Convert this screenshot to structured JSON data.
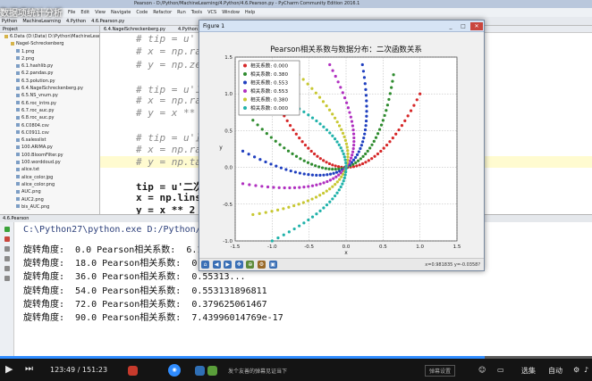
{
  "ide": {
    "title": "Pearson - D:/Python/MachineLearning/4.Python/4.6.Pearson.py - PyCharm Community Edition 2016.1",
    "overlay_title": "数据项统计分析",
    "menu": [
      "File",
      "Edit",
      "View",
      "Navigate",
      "Code",
      "Refactor",
      "Run",
      "Tools",
      "VCS",
      "Window",
      "Help"
    ],
    "toolbar": [
      "Python",
      "MachineLearning",
      "4.Python",
      "4.6.Pearson.py"
    ]
  },
  "project": {
    "header": "Project",
    "items": [
      {
        "label": "6.Data  (D:\\Data)  D:\\Python\\MachineLearn",
        "level": 0
      },
      {
        "label": "Nagel-Schreckenberg",
        "level": 1
      },
      {
        "label": "1.png",
        "level": 2
      },
      {
        "label": "2.png",
        "level": 2
      },
      {
        "label": "6.1.hashlib.py",
        "level": 2
      },
      {
        "label": "6.2.pandas.py",
        "level": 2
      },
      {
        "label": "6.3.polution.py",
        "level": 2
      },
      {
        "label": "6.4.NagelSchreckenberg.py",
        "level": 2
      },
      {
        "label": "6.5.NS_vnum.py",
        "level": 2
      },
      {
        "label": "6.6.roc_intro.py",
        "level": 2
      },
      {
        "label": "6.7.roc_auc.py",
        "level": 2
      },
      {
        "label": "6.8.roc_auc.py",
        "level": 2
      },
      {
        "label": "6.C0804.csv",
        "level": 2
      },
      {
        "label": "6.C0911.csv",
        "level": 2
      },
      {
        "label": "6.salesslist",
        "level": 2
      },
      {
        "label": "100.ARIMA.py",
        "level": 2
      },
      {
        "label": "100.BloomFilter.py",
        "level": 2
      },
      {
        "label": "100.worddoud.py",
        "level": 2
      },
      {
        "label": "alice.txt",
        "level": 2
      },
      {
        "label": "alice_color.jpg",
        "level": 2
      },
      {
        "label": "alice_color.png",
        "level": 2
      },
      {
        "label": "AUC.png",
        "level": 2
      },
      {
        "label": "AUC2.png",
        "level": 2
      },
      {
        "label": "bis_AUC.png",
        "level": 2
      }
    ]
  },
  "editor": {
    "tabs": [
      "6.4.NagelSchreckenberg.py",
      "4.Python",
      "4.6.Pearson.py"
    ],
    "lines": [
      {
        "text": "# tip = u'",
        "type": "comment",
        "y": 8
      },
      {
        "text": "# x = np.ran",
        "type": "comment",
        "y": 22
      },
      {
        "text": "# y = np.zer",
        "type": "comment",
        "y": 37
      },
      {
        "text": "# tip = u'二",
        "type": "comment",
        "y": 63
      },
      {
        "text": "# x = np.ran",
        "type": "comment",
        "y": 77
      },
      {
        "text": "# y = x ** 2",
        "type": "comment",
        "y": 91
      },
      {
        "text": "# tip = u'正",
        "type": "comment",
        "y": 117
      },
      {
        "text": "# x = np.ran",
        "type": "comment",
        "y": 132
      },
      {
        "text": "# y = np.tan",
        "type": "comment",
        "y": 146
      },
      {
        "text": "tip = u'二次",
        "type": "code",
        "y": 172
      },
      {
        "text": "x = np.linsp",
        "type": "code",
        "y": 186
      },
      {
        "text": "y = x ** 2",
        "type": "code",
        "y": 200
      },
      {
        "text": "# tip = u'椭",
        "type": "comment",
        "y": 226
      }
    ]
  },
  "figure": {
    "window_title": "Figure 1",
    "coords": "x=0.981835  y=-0.0358?"
  },
  "chart_data": {
    "type": "scatter",
    "title": "Pearson相关系数与数据分布：二次函数关系",
    "xlabel": "x",
    "ylabel": "y",
    "xlim": [
      -1.5,
      1.5
    ],
    "ylim": [
      -1.0,
      1.5
    ],
    "xticks": [
      "-1.5",
      "-1.0",
      "-0.5",
      "0.0",
      "0.5",
      "1.0",
      "1.5"
    ],
    "yticks": [
      "-1.0",
      "-0.5",
      "0.0",
      "0.5",
      "1.0",
      "1.5"
    ],
    "grid": true,
    "legend_position": "upper-left",
    "base_curve": "y = x ** 2, x in [-1, 1], rotated by each angle",
    "series": [
      {
        "name": "相关系数: 0.000",
        "angle": 0,
        "color": "#d62728"
      },
      {
        "name": "相关系数: 0.380",
        "angle": 18,
        "color": "#2e8b2e"
      },
      {
        "name": "相关系数: 0.553",
        "angle": 36,
        "color": "#1f3fbf"
      },
      {
        "name": "相关系数: 0.553",
        "angle": 54,
        "color": "#b030c0"
      },
      {
        "name": "相关系数: 0.380",
        "angle": 72,
        "color": "#c8c832"
      },
      {
        "name": "相关系数: 0.000",
        "angle": 90,
        "color": "#20b2aa"
      }
    ]
  },
  "console": {
    "tab_label": "4.6.Pearson",
    "command": "C:\\Python27\\python.exe D:/Python/MachineLearning/4.Python/4.6.Pearson.py",
    "lines": [
      "旋转角度:  0.0 Pearson相关系数:  6.19992597...",
      "旋转角度:  18.0 Pearson相关系数:  0.37962...",
      "旋转角度:  36.0 Pearson相关系数:  0.55313...",
      "旋转角度:  54.0 Pearson相关系数:  0.553131896811",
      "旋转角度:  72.0 Pearson相关系数:  0.379625061467",
      "旋转角度:  90.0 Pearson相关系数:  7.43996014769e-17"
    ]
  },
  "player": {
    "time": "123:49 / 151:23",
    "progress": 0.818,
    "sub_label": "弹幕设置",
    "right_label_a": "选集",
    "right_label_b": "自动",
    "danmaku_hint": "发个友善的弹幕见证当下"
  }
}
